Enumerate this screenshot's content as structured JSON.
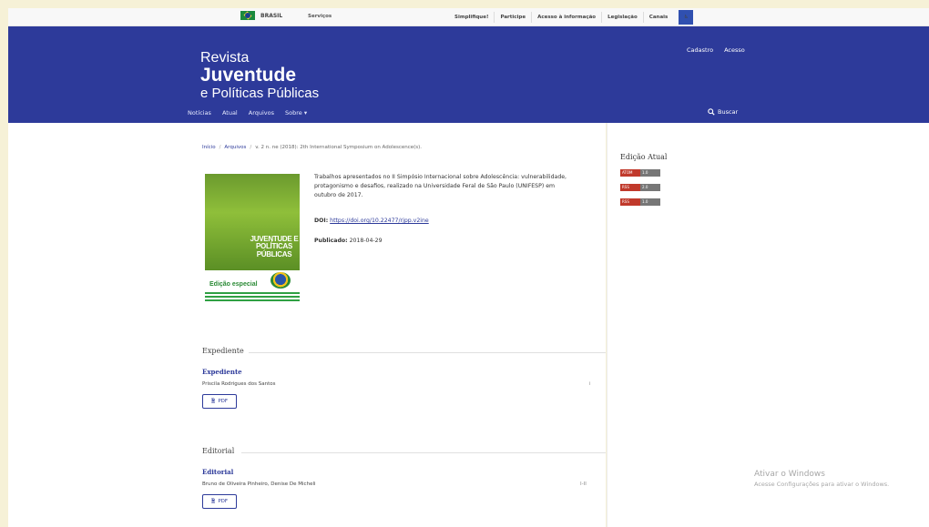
{
  "govbar": {
    "brasil": "BRASIL",
    "servicos": "Serviços",
    "links": [
      "Simplifique!",
      "Participe",
      "Acesso à informação",
      "Legislação",
      "Canais"
    ]
  },
  "header": {
    "logo_line1": "Revista",
    "logo_line2": "Juventude",
    "logo_line3": "e Políticas Públicas",
    "user_nav": [
      "Cadastro",
      "Acesso"
    ],
    "main_nav": [
      "Notícias",
      "Atual",
      "Arquivos",
      "Sobre ▾"
    ],
    "search_label": "Buscar"
  },
  "breadcrumb": {
    "home": "Início",
    "archives": "Arquivos",
    "current": "v. 2 n. ne (2018): 2th International Symposium on Adolescence(s)."
  },
  "issue": {
    "cover_text": "JUVENTUDE E POLÍTICAS PÚBLICAS",
    "cover_edition": "Edição especial",
    "description": "Trabalhos apresentados no II Simpósio Internacional sobre Adolescência: vulnerabilidade, protagonismo e desafios, realizado na Universidade Feral de São Paulo (UNIFESP) em outubro de 2017.",
    "doi_label": "DOI:",
    "doi_link": "https://doi.org/10.22477/rjpp.v2ine",
    "published_label": "Publicado:",
    "published_date": "2018-04-29"
  },
  "sections": [
    {
      "title": "Expediente",
      "article_title": "Expediente",
      "authors": "Priscila Rodrigues dos Santos",
      "pages": "i",
      "pdf_label": "PDF"
    },
    {
      "title": "Editorial",
      "article_title": "Editorial",
      "authors": "Bruno de Oliveira Pinheiro, Denise De Micheli",
      "pages": "I-II",
      "pdf_label": "PDF"
    }
  ],
  "sidebar": {
    "title": "Edição Atual",
    "badges": [
      {
        "left": "ATOM",
        "right": "1.0"
      },
      {
        "left": "RSS",
        "right": "2.0"
      },
      {
        "left": "RSS",
        "right": "1.0"
      }
    ]
  },
  "watermark": {
    "line1": "Ativar o Windows",
    "line2": "Acesse Configurações para ativar o Windows."
  }
}
